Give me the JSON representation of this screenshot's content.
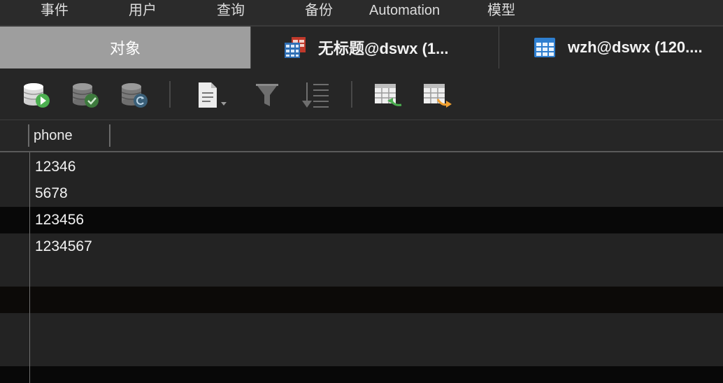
{
  "menu": {
    "items": [
      {
        "label": "事件"
      },
      {
        "label": "用户"
      },
      {
        "label": "查询"
      },
      {
        "label": "备份"
      },
      {
        "label": "Automation"
      },
      {
        "label": "模型"
      }
    ]
  },
  "tabs": [
    {
      "label": "对象",
      "active": true
    },
    {
      "label": "无标题@dswx (1...",
      "icon": "query-table-icon"
    },
    {
      "label": "wzh@dswx (120....",
      "icon": "table-icon"
    }
  ],
  "toolbar": {
    "buttons": [
      {
        "icon": "database-run-icon"
      },
      {
        "icon": "database-check-icon"
      },
      {
        "icon": "database-refresh-icon"
      },
      {
        "icon": "document-dropdown-icon"
      },
      {
        "icon": "filter-icon"
      },
      {
        "icon": "sort-icon"
      },
      {
        "icon": "import-table-icon"
      },
      {
        "icon": "export-table-icon"
      }
    ]
  },
  "grid": {
    "columns": [
      "phone"
    ],
    "rows": [
      {
        "phone": "12346"
      },
      {
        "phone": "5678"
      },
      {
        "phone": "123456"
      },
      {
        "phone": "1234567"
      }
    ]
  },
  "colors": {
    "background": "#232323",
    "row_dark": "#080808",
    "row_warm": "#0c0a08",
    "active_tab": "#9e9e9e",
    "green_accent": "#4caf50",
    "orange_accent": "#f0a030"
  }
}
